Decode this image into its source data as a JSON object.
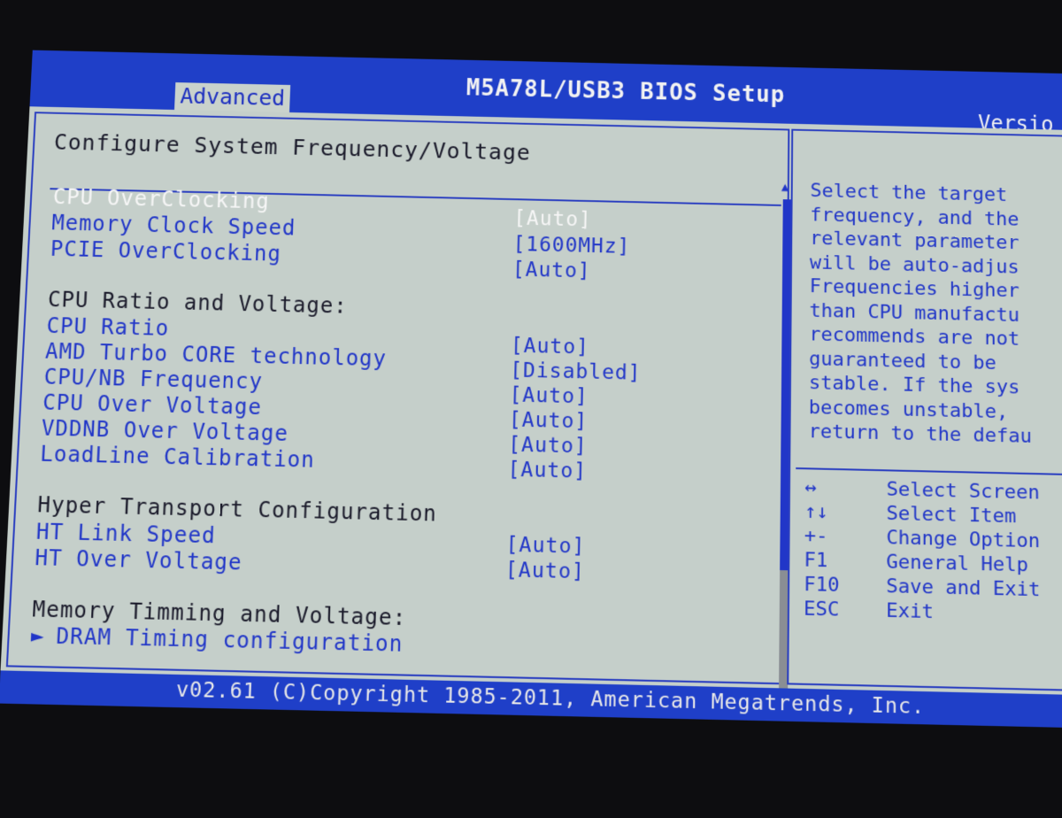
{
  "header": {
    "title": "M5A78L/USB3 BIOS Setup",
    "active_tab": "Advanced",
    "version": "Versio"
  },
  "main": {
    "section_title": "Configure System Frequency/Voltage",
    "items": [
      {
        "label": "CPU OverClocking",
        "value": "[Auto]"
      },
      {
        "label": "Memory Clock Speed",
        "value": "[1600MHz]"
      },
      {
        "label": "PCIE OverClocking",
        "value": "[Auto]"
      }
    ],
    "cpu_group_heading": "CPU Ratio and Voltage:",
    "cpu_items": [
      {
        "label": "CPU Ratio",
        "value": "[Auto]"
      },
      {
        "label": "AMD Turbo CORE technology",
        "value": "[Disabled]"
      },
      {
        "label": "CPU/NB Frequency",
        "value": "[Auto]"
      },
      {
        "label": "CPU Over Voltage",
        "value": "[Auto]"
      },
      {
        "label": "VDDNB Over Voltage",
        "value": "[Auto]"
      },
      {
        "label": "LoadLine Calibration",
        "value": "[Auto]"
      }
    ],
    "ht_group_heading": "Hyper Transport Configuration",
    "ht_items": [
      {
        "label": "HT Link Speed",
        "value": "[Auto]"
      },
      {
        "label": "HT Over Voltage",
        "value": "[Auto]"
      }
    ],
    "mem_group_heading": "Memory Timming and Voltage:",
    "submenu": {
      "arrow": "►",
      "label": "DRAM Timing configuration"
    }
  },
  "help": {
    "text": "Select the target\nfrequency, and the\nrelevant parameter\nwill be auto-adjus\nFrequencies higher\nthan CPU manufactu\nrecommends are not\nguaranteed to be\nstable. If the sys\nbecomes unstable,\nreturn to the defau"
  },
  "keys": [
    {
      "key": "↔",
      "action": "Select Screen"
    },
    {
      "key": "↑↓",
      "action": "Select Item"
    },
    {
      "key": "+-",
      "action": "Change Option"
    },
    {
      "key": "F1",
      "action": "General Help"
    },
    {
      "key": "F10",
      "action": "Save and Exit"
    },
    {
      "key": "ESC",
      "action": "Exit"
    }
  ],
  "footer": {
    "text": "v02.61 (C)Copyright 1985-2011, American Megatrends, Inc."
  },
  "colors": {
    "bios_blue": "#1f3fc8",
    "panel_gray": "#c5cfca",
    "text_blue": "#2136c8",
    "highlight_white": "#f6f6f6"
  }
}
